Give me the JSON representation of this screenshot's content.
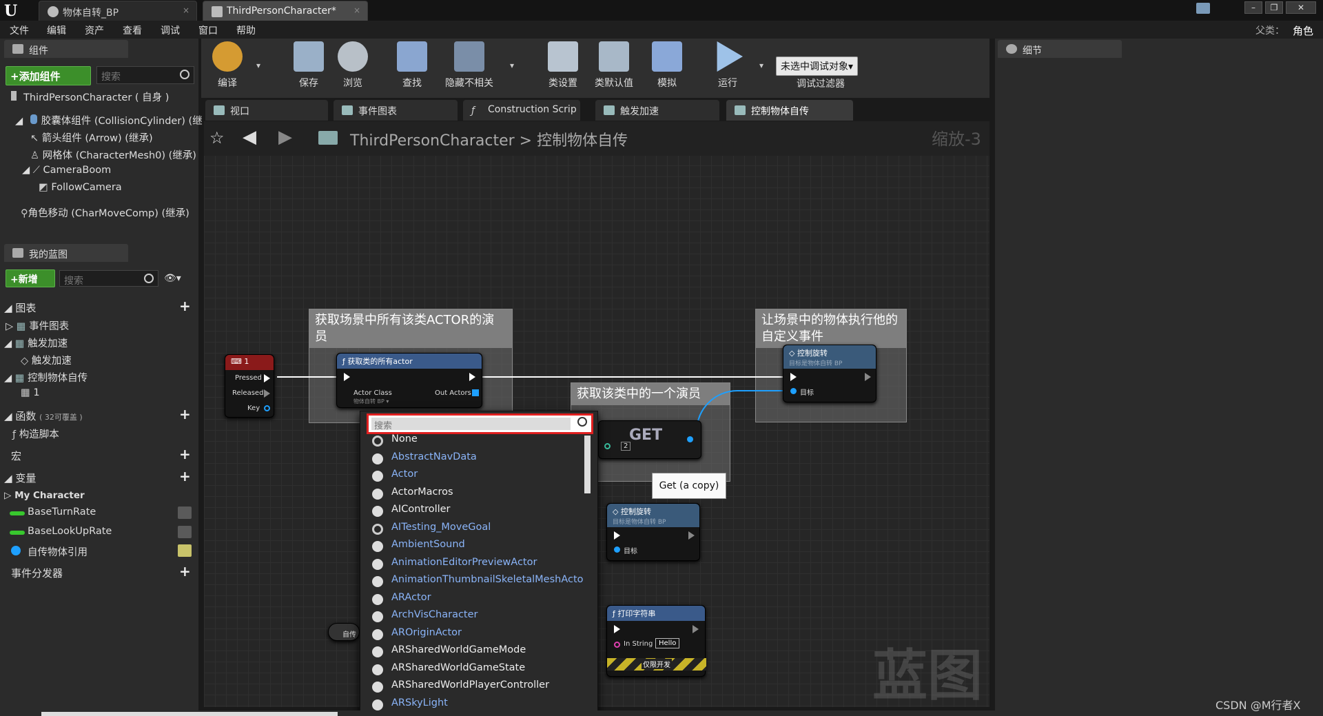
{
  "window": {
    "tabs": [
      {
        "label": "物体自转_BP"
      },
      {
        "label": "ThirdPersonCharacter*"
      }
    ],
    "parent_label": "父类：",
    "parent_value": "角色"
  },
  "menu": [
    "文件",
    "编辑",
    "资产",
    "查看",
    "调试",
    "窗口",
    "帮助"
  ],
  "components": {
    "tab": "组件",
    "add_button": "+添加组件",
    "search_placeholder": "搜索",
    "root": "ThirdPersonCharacter ( 自身 )",
    "items": [
      "胶囊体组件 (CollisionCylinder) (继",
      "箭头组件 (Arrow) (继承)",
      "网格体 (CharacterMesh0) (继承)",
      "CameraBoom",
      "FollowCamera",
      "角色移动 (CharMoveComp) (继承)"
    ]
  },
  "my_blueprint": {
    "tab": "我的蓝图",
    "new_button": "+新增",
    "search_placeholder": "搜索",
    "graphs_label": "图表",
    "graphs": [
      "事件图表",
      "触发加速",
      "触发加速",
      "控制物体自传",
      "1"
    ],
    "functions_label": "函数",
    "functions_note": "( 32可覆盖 )",
    "functions": [
      "构造脚本"
    ],
    "macros_label": "宏",
    "variables_label": "变量",
    "category": "My Character",
    "variables": [
      "BaseTurnRate",
      "BaseLookUpRate",
      "自传物体引用"
    ],
    "dispatchers_label": "事件分发器"
  },
  "toolbar": {
    "buttons": [
      "编译",
      "保存",
      "浏览",
      "查找",
      "隐藏不相关",
      "类设置",
      "类默认值",
      "模拟",
      "运行"
    ],
    "debug_select": "未选中调试对象▾",
    "debug_filter": "调试过滤器"
  },
  "graph_tabs": [
    "视口",
    "事件图表",
    "Construction Scrip",
    "触发加速",
    "控制物体自传"
  ],
  "breadcrumb": {
    "root": "ThirdPersonCharacter",
    "sep": ">",
    "current": "控制物体自传",
    "zoom": "缩放-3"
  },
  "comments": [
    "获取场景中所有该类ACTOR的演员",
    "让场景中的物体执行他的自定义事件",
    "获取该类中的一个演员"
  ],
  "nodes": {
    "key_event": {
      "title": "1",
      "pins": [
        "Pressed",
        "Released",
        "Key"
      ]
    },
    "get_all": {
      "title": "获取类的所有actor",
      "in": "Actor Class",
      "out": "Out Actors",
      "sub": "物体自转 BP ▾"
    },
    "get": {
      "title": "GET",
      "index": "2"
    },
    "custom1": {
      "title": "控制旋转",
      "sub": "目标是物体自转 BP",
      "pin": "目标"
    },
    "custom2": {
      "title": "控制旋转",
      "sub": "目标是物体自转 BP",
      "pin": "目标"
    },
    "print": {
      "title": "打印字符串",
      "in": "In String",
      "value": "Hello",
      "dev": "仅限开发"
    },
    "var_get": {
      "label": "自传"
    }
  },
  "tooltip": "Get (a copy)",
  "popup": {
    "search_placeholder": "搜索",
    "items": [
      {
        "label": "None",
        "style": "white"
      },
      {
        "label": "AbstractNavData",
        "style": "blue"
      },
      {
        "label": "Actor",
        "style": "blue"
      },
      {
        "label": "ActorMacros",
        "style": "white"
      },
      {
        "label": "AIController",
        "style": "white"
      },
      {
        "label": "AITesting_MoveGoal",
        "style": "blue"
      },
      {
        "label": "AmbientSound",
        "style": "blue"
      },
      {
        "label": "AnimationEditorPreviewActor",
        "style": "blue"
      },
      {
        "label": "AnimationThumbnailSkeletalMeshActo",
        "style": "blue"
      },
      {
        "label": "ARActor",
        "style": "blue"
      },
      {
        "label": "ArchVisCharacter",
        "style": "blue"
      },
      {
        "label": "AROriginActor",
        "style": "blue"
      },
      {
        "label": "ARSharedWorldGameMode",
        "style": "white"
      },
      {
        "label": "ARSharedWorldGameState",
        "style": "white"
      },
      {
        "label": "ARSharedWorldPlayerController",
        "style": "white"
      },
      {
        "label": "ARSkyLight",
        "style": "blue"
      }
    ]
  },
  "details": {
    "tab": "细节"
  },
  "watermark": "蓝图",
  "credit": "CSDN @M行者X"
}
